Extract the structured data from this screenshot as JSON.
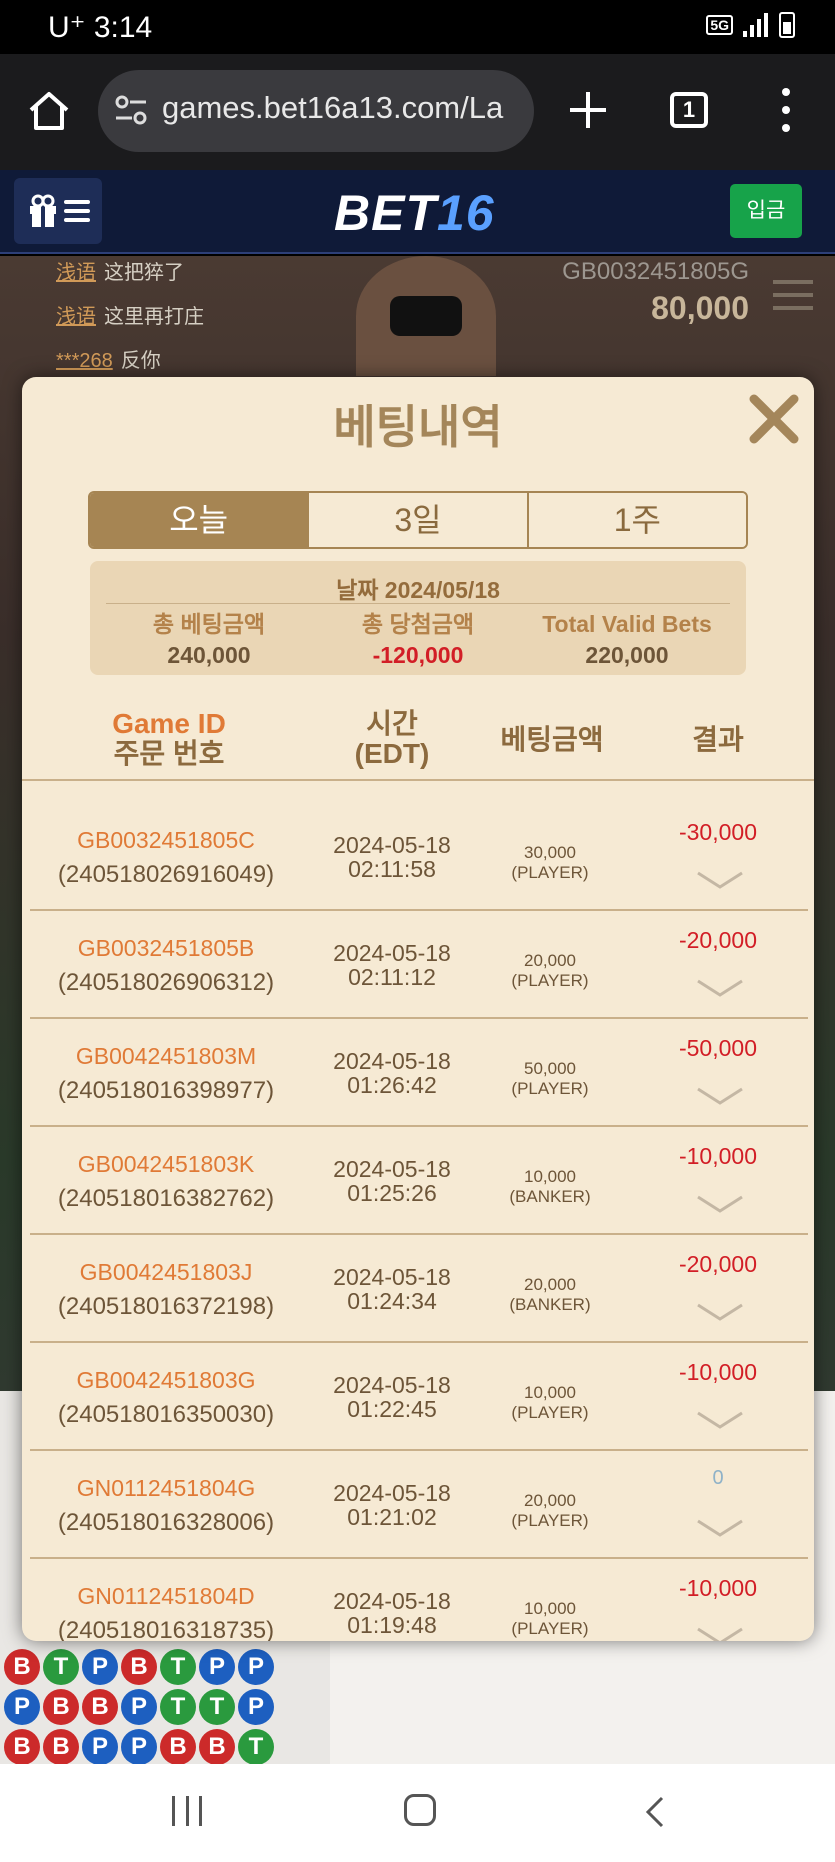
{
  "status_bar": {
    "carrier": "U⁺ 3:14",
    "network": "5G"
  },
  "browser": {
    "url": "games.bet16a13.com/La",
    "tab_count": "1"
  },
  "site_header": {
    "logo_part1": "BET",
    "logo_part2": "16",
    "deposit_label": "입금"
  },
  "background": {
    "chat": [
      {
        "user": "浅语",
        "msg": "这把猝了"
      },
      {
        "user": "浅语",
        "msg": "这里再打庄"
      },
      {
        "user": "***268",
        "msg": "反你"
      }
    ],
    "game_id": "GB0032451805G",
    "balance": "80,000"
  },
  "modal": {
    "title": "베팅내역",
    "tabs": [
      {
        "label": "오늘",
        "active": true
      },
      {
        "label": "3일",
        "active": false
      },
      {
        "label": "1주",
        "active": false
      }
    ],
    "summary": {
      "date": "날짜 2024/05/18",
      "total_bet_label": "총 베팅금액",
      "total_bet_value": "240,000",
      "total_win_label": "총 당첨금액",
      "total_win_value": "-120,000",
      "valid_bets_label": "Total Valid Bets",
      "valid_bets_value": "220,000"
    },
    "columns": {
      "game_id": "Game ID",
      "order_no": "주문 번호",
      "time": "시간",
      "time_zone": "(EDT)",
      "amount": "베팅금액",
      "result": "결과"
    },
    "rows": [
      {
        "game_id": "GB0032451805C",
        "order_id": "(240518026916049)",
        "date": "2024-05-18",
        "time": "02:11:58",
        "amount": "30,000",
        "side": "(PLAYER)",
        "result": "-30,000"
      },
      {
        "game_id": "GB0032451805B",
        "order_id": "(240518026906312)",
        "date": "2024-05-18",
        "time": "02:11:12",
        "amount": "20,000",
        "side": "(PLAYER)",
        "result": "-20,000"
      },
      {
        "game_id": "GB0042451803M",
        "order_id": "(240518016398977)",
        "date": "2024-05-18",
        "time": "01:26:42",
        "amount": "50,000",
        "side": "(PLAYER)",
        "result": "-50,000"
      },
      {
        "game_id": "GB0042451803K",
        "order_id": "(240518016382762)",
        "date": "2024-05-18",
        "time": "01:25:26",
        "amount": "10,000",
        "side": "(BANKER)",
        "result": "-10,000"
      },
      {
        "game_id": "GB0042451803J",
        "order_id": "(240518016372198)",
        "date": "2024-05-18",
        "time": "01:24:34",
        "amount": "20,000",
        "side": "(BANKER)",
        "result": "-20,000"
      },
      {
        "game_id": "GB0042451803G",
        "order_id": "(240518016350030)",
        "date": "2024-05-18",
        "time": "01:22:45",
        "amount": "10,000",
        "side": "(PLAYER)",
        "result": "-10,000"
      },
      {
        "game_id": "GN0112451804G",
        "order_id": "(240518016328006)",
        "date": "2024-05-18",
        "time": "01:21:02",
        "amount": "20,000",
        "side": "(PLAYER)",
        "result": "0"
      },
      {
        "game_id": "GN0112451804D",
        "order_id": "(240518016318735)",
        "date": "2024-05-18",
        "time": "01:19:48",
        "amount": "10,000",
        "side": "(PLAYER)",
        "result": "-10,000"
      }
    ]
  },
  "bead_road": [
    [
      "B",
      "T",
      "P",
      "B",
      "T",
      "P",
      "P"
    ],
    [
      "P",
      "B",
      "B",
      "P",
      "T",
      "T",
      "P"
    ],
    [
      "B",
      "B",
      "P",
      "P",
      "B",
      "B",
      "T"
    ]
  ],
  "colors": {
    "modal_bg": "#f6ead4",
    "accent": "#a68553",
    "loss": "#d21e26",
    "game_id": "#e07a36",
    "deposit": "#17a34a"
  }
}
